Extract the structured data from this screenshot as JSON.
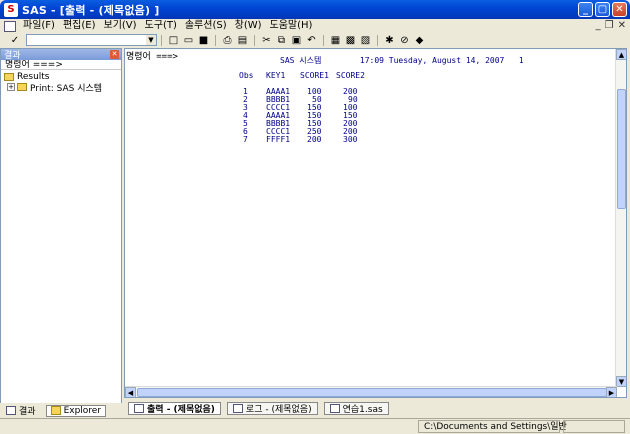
{
  "window": {
    "title": "SAS - [출력 - (제목없음) ]"
  },
  "menu": {
    "items": [
      "파일(F)",
      "편집(E)",
      "보기(V)",
      "도구(T)",
      "솔루션(S)",
      "창(W)",
      "도움말(H)"
    ]
  },
  "toolbar": {
    "command_value": ""
  },
  "left_panel": {
    "title": "결과",
    "command_line": "명령어 ===>",
    "tree": [
      {
        "label": "Results"
      },
      {
        "label": "Print:  SAS 시스템"
      }
    ],
    "tabs": [
      {
        "label": "결과"
      },
      {
        "label": "Explorer"
      }
    ]
  },
  "output": {
    "command_line": "명령어 ===>",
    "report_title": "SAS 시스템        17:09 Tuesday, August 14, 2007   1",
    "columns": [
      "Obs",
      "KEY1",
      "SCORE1",
      "SCORE2"
    ],
    "rows": [
      [
        "1",
        "AAAA1",
        "100",
        "200"
      ],
      [
        "2",
        "BBBB1",
        "50",
        "90"
      ],
      [
        "3",
        "CCCC1",
        "150",
        "100"
      ],
      [
        "4",
        "AAAA1",
        "150",
        "150"
      ],
      [
        "5",
        "BBBB1",
        "150",
        "200"
      ],
      [
        "6",
        "CCCC1",
        "250",
        "200"
      ],
      [
        "7",
        "FFFF1",
        "200",
        "300"
      ]
    ]
  },
  "window_tabs": [
    {
      "label": "출력 - (제목없음)"
    },
    {
      "label": "로그 - (제목없음)"
    },
    {
      "label": "연습1.sas"
    }
  ],
  "status": {
    "path": "C:\\Documents and Settings\\일반"
  }
}
